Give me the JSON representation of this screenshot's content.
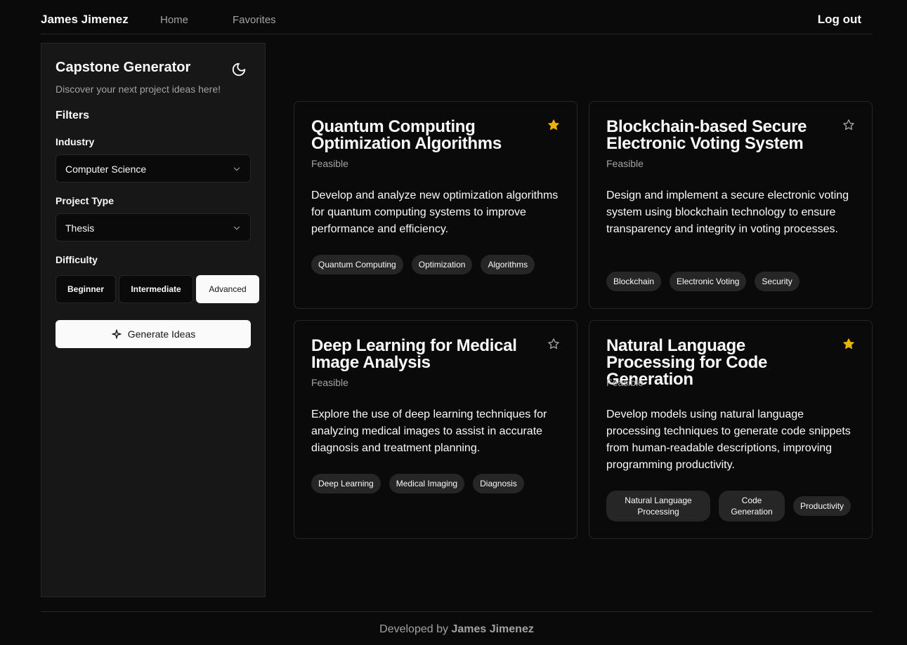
{
  "nav": {
    "brand": "James Jimenez",
    "home": "Home",
    "favorites": "Favorites",
    "logout": "Log out"
  },
  "sidebar": {
    "title": "Capstone Generator",
    "theme_icon": "moon-icon",
    "subtitle": "Discover your next project ideas here!",
    "filters_heading": "Filters",
    "industry_label": "Industry",
    "industry_value": "Computer Science",
    "project_type_label": "Project Type",
    "project_type_value": "Thesis",
    "difficulty_label": "Difficulty",
    "difficulty_options": [
      "Beginner",
      "Intermediate",
      "Advanced"
    ],
    "difficulty_selected": "Advanced",
    "generate_label": "Generate Ideas",
    "generate_icon": "sparkle-icon"
  },
  "cards": [
    {
      "title": "Quantum Computing Optimization Algorithms",
      "status": "Feasible",
      "favorite": true,
      "description": "Develop and analyze new optimization algorithms for quantum computing systems to improve performance and efficiency.",
      "tags": [
        "Quantum Computing",
        "Optimization",
        "Algorithms"
      ]
    },
    {
      "title": "Blockchain-based Secure Electronic Voting System",
      "status": "Feasible",
      "favorite": false,
      "description": "Design and implement a secure electronic voting system using blockchain technology to ensure transparency and integrity in voting processes.",
      "tags": [
        "Blockchain",
        "Electronic Voting",
        "Security"
      ]
    },
    {
      "title": "Deep Learning for Medical Image Analysis",
      "status": "Feasible",
      "favorite": false,
      "description": "Explore the use of deep learning techniques for analyzing medical images to assist in accurate diagnosis and treatment planning.",
      "tags": [
        "Deep Learning",
        "Medical Imaging",
        "Diagnosis"
      ]
    },
    {
      "title": "Natural Language Processing for Code Generation",
      "status": "Feasible",
      "favorite": true,
      "description": "Develop models using natural language processing techniques to generate code snippets from human-readable descriptions, improving programming productivity.",
      "tags": [
        "Natural Language Processing",
        "Code Generation",
        "Productivity"
      ]
    }
  ],
  "colors": {
    "background": "#0a0a0a",
    "panel": "#171717",
    "border": "#262626",
    "star_active": "#eab308",
    "muted_text": "#a3a3a3"
  },
  "footer": {
    "prefix": "Developed by",
    "name": "James Jimenez"
  }
}
